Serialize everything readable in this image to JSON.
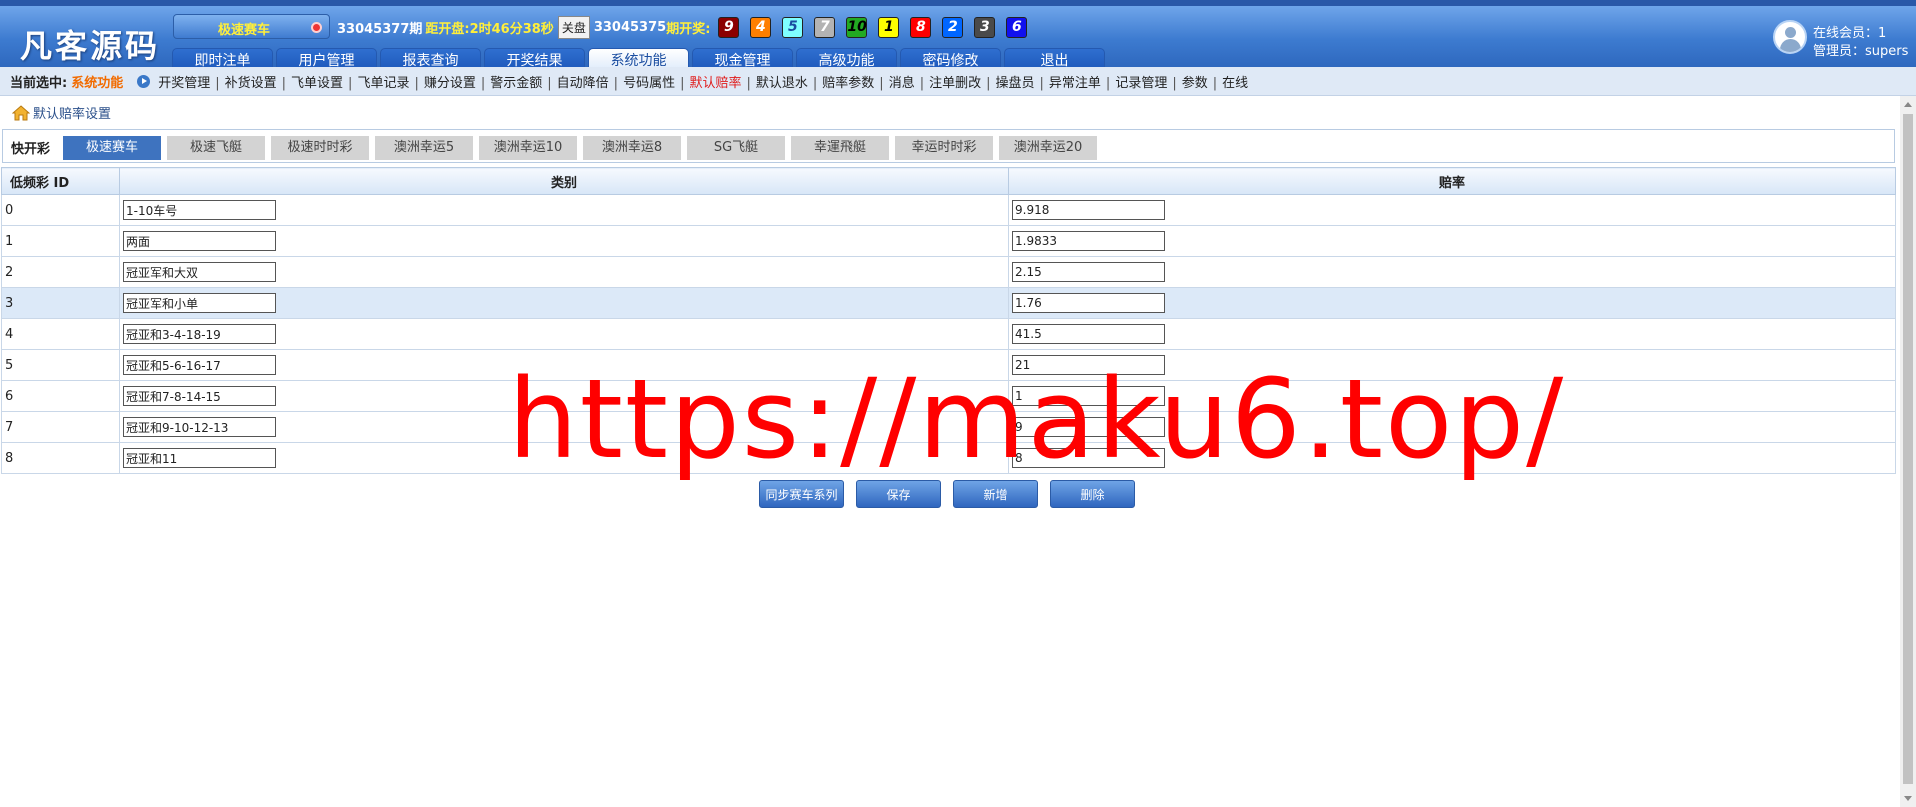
{
  "header": {
    "logo": "凡客源码",
    "game_pill": "极速赛车",
    "current_issue": "33045377期",
    "countdown_label": "距开盘:",
    "countdown_value": "2时46分38秒",
    "close_button": "关盘",
    "draw_issue": "33045375",
    "draw_label": "期开奖:",
    "balls": [
      {
        "n": "9",
        "bg": "#8b0000",
        "fg": "#ffffff"
      },
      {
        "n": "4",
        "bg": "#ff7f00",
        "fg": "#ffffff"
      },
      {
        "n": "5",
        "bg": "#7fffff",
        "fg": "#1a4da0"
      },
      {
        "n": "7",
        "bg": "#b3b3b3",
        "fg": "#ffffff"
      },
      {
        "n": "10",
        "bg": "#22aa22",
        "fg": "#000000"
      },
      {
        "n": "1",
        "bg": "#ffff00",
        "fg": "#000000"
      },
      {
        "n": "8",
        "bg": "#ff0000",
        "fg": "#ffffff"
      },
      {
        "n": "2",
        "bg": "#0066ff",
        "fg": "#ffffff"
      },
      {
        "n": "3",
        "bg": "#4a4a4a",
        "fg": "#ffffff"
      },
      {
        "n": "6",
        "bg": "#1111ee",
        "fg": "#ffffff"
      }
    ],
    "nav_tabs": [
      "即时注单",
      "用户管理",
      "报表查询",
      "开奖结果",
      "系统功能",
      "现金管理",
      "高级功能",
      "密码修改",
      "退出"
    ],
    "active_nav": "系统功能",
    "online_members": "在线会员：1",
    "admin": "管理员：supers"
  },
  "subnav": {
    "current_label": "当前选中:",
    "current_value": "系统功能",
    "links": [
      "开奖管理",
      "补货设置",
      "飞单设置",
      "飞单记录",
      "赚分设置",
      "警示金额",
      "自动降倍",
      "号码属性",
      "默认赔率",
      "默认退水",
      "赔率参数",
      "消息",
      "注单删改",
      "操盘员",
      "异常注单",
      "记录管理",
      "参数",
      "在线"
    ],
    "active_link": "默认赔率"
  },
  "breadcrumb": "默认赔率设置",
  "game_tabs": {
    "label": "快开彩",
    "tabs": [
      "极速赛车",
      "极速飞艇",
      "极速时时彩",
      "澳洲幸运5",
      "澳洲幸运10",
      "澳洲幸运8",
      "SG飞艇",
      "幸運飛艇",
      "幸运时时彩",
      "澳洲幸运20"
    ],
    "active": "极速赛车"
  },
  "table": {
    "headers": [
      "低频彩 ID",
      "类别",
      "赔率"
    ],
    "highlight_row": 3,
    "rows": [
      {
        "id": "0",
        "category": "1-10车号",
        "odds": "9.918"
      },
      {
        "id": "1",
        "category": "两面",
        "odds": "1.9833"
      },
      {
        "id": "2",
        "category": "冠亚军和大双",
        "odds": "2.15"
      },
      {
        "id": "3",
        "category": "冠亚军和小单",
        "odds": "1.76"
      },
      {
        "id": "4",
        "category": "冠亚和3-4-18-19",
        "odds": "41.5"
      },
      {
        "id": "5",
        "category": "冠亚和5-6-16-17",
        "odds": "21"
      },
      {
        "id": "6",
        "category": "冠亚和7-8-14-15",
        "odds": "1"
      },
      {
        "id": "7",
        "category": "冠亚和9-10-12-13",
        "odds": "9"
      },
      {
        "id": "8",
        "category": "冠亚和11",
        "odds": "8"
      }
    ]
  },
  "buttons": [
    "同步赛车系列",
    "保存",
    "新增",
    "删除"
  ],
  "watermark": "https://maku6.top/"
}
